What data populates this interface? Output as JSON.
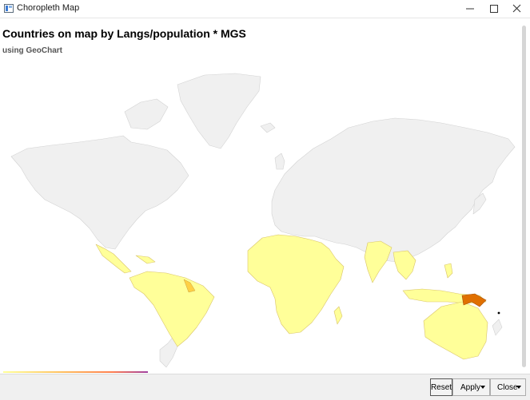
{
  "window": {
    "title": "Choropleth Map",
    "icon": "map-icon"
  },
  "page": {
    "title": "Countries on map by Langs/population * MGS",
    "subtitle": "using GeoChart"
  },
  "map": {
    "type": "geochart",
    "colors": {
      "no_data": "#f0f0f0",
      "border": "#d2d2d2",
      "low": "#ffff99",
      "mid": "#ffd045",
      "high": "#e07000",
      "peak": "#000000"
    }
  },
  "colorbar": {
    "stops": [
      "#ffff99",
      "#ffc060",
      "#ff8050",
      "#a040a0"
    ]
  },
  "buttons": {
    "reset": "Reset",
    "apply": "Apply",
    "close": "Close"
  }
}
